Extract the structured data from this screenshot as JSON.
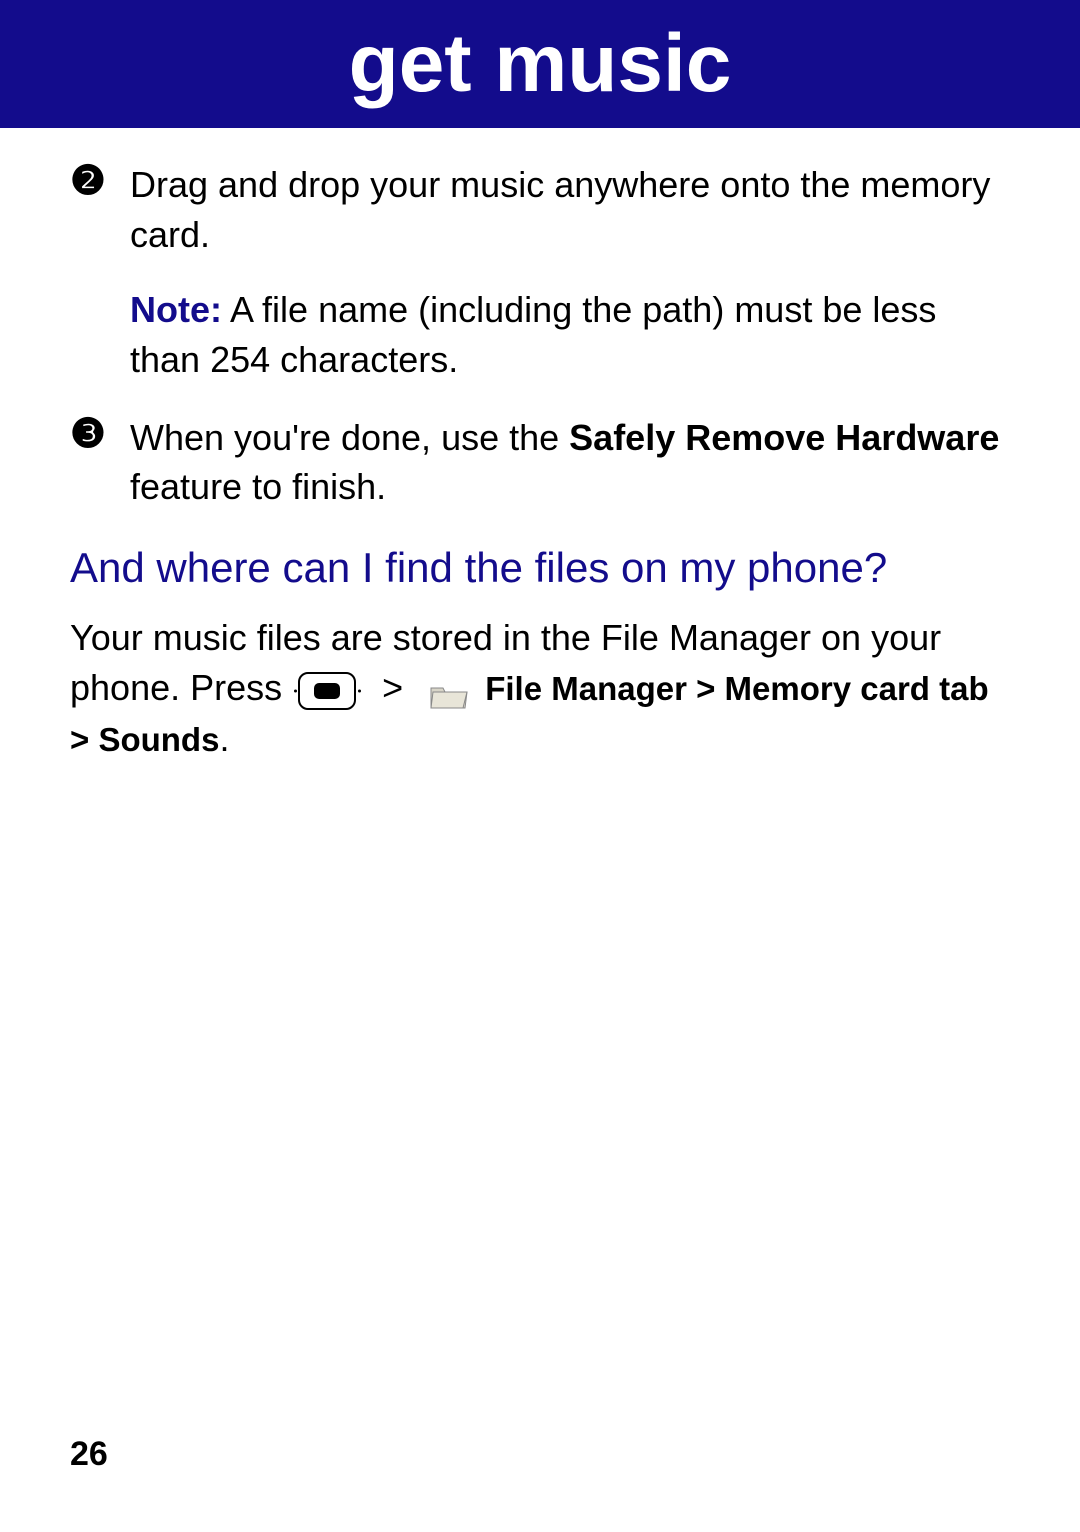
{
  "header": {
    "title": "get music"
  },
  "steps": [
    {
      "number": "❷",
      "text": "Drag and drop your music anywhere onto the memory card.",
      "note_label": "Note:",
      "note_text": " A file name (including the path) must be less than 254 characters."
    },
    {
      "number": "❸",
      "text_before": "When you're done, use the ",
      "bold1": "Safely Remove Hardware",
      "text_after": " feature to finish."
    }
  ],
  "section": {
    "heading": "And where can I find the files on my phone?",
    "body_prefix": "Your music files are stored in the File Manager on your phone. Press ",
    "sep": ">",
    "path": "File Manager > Memory card tab > Sounds",
    "period": "."
  },
  "page_number": "26"
}
